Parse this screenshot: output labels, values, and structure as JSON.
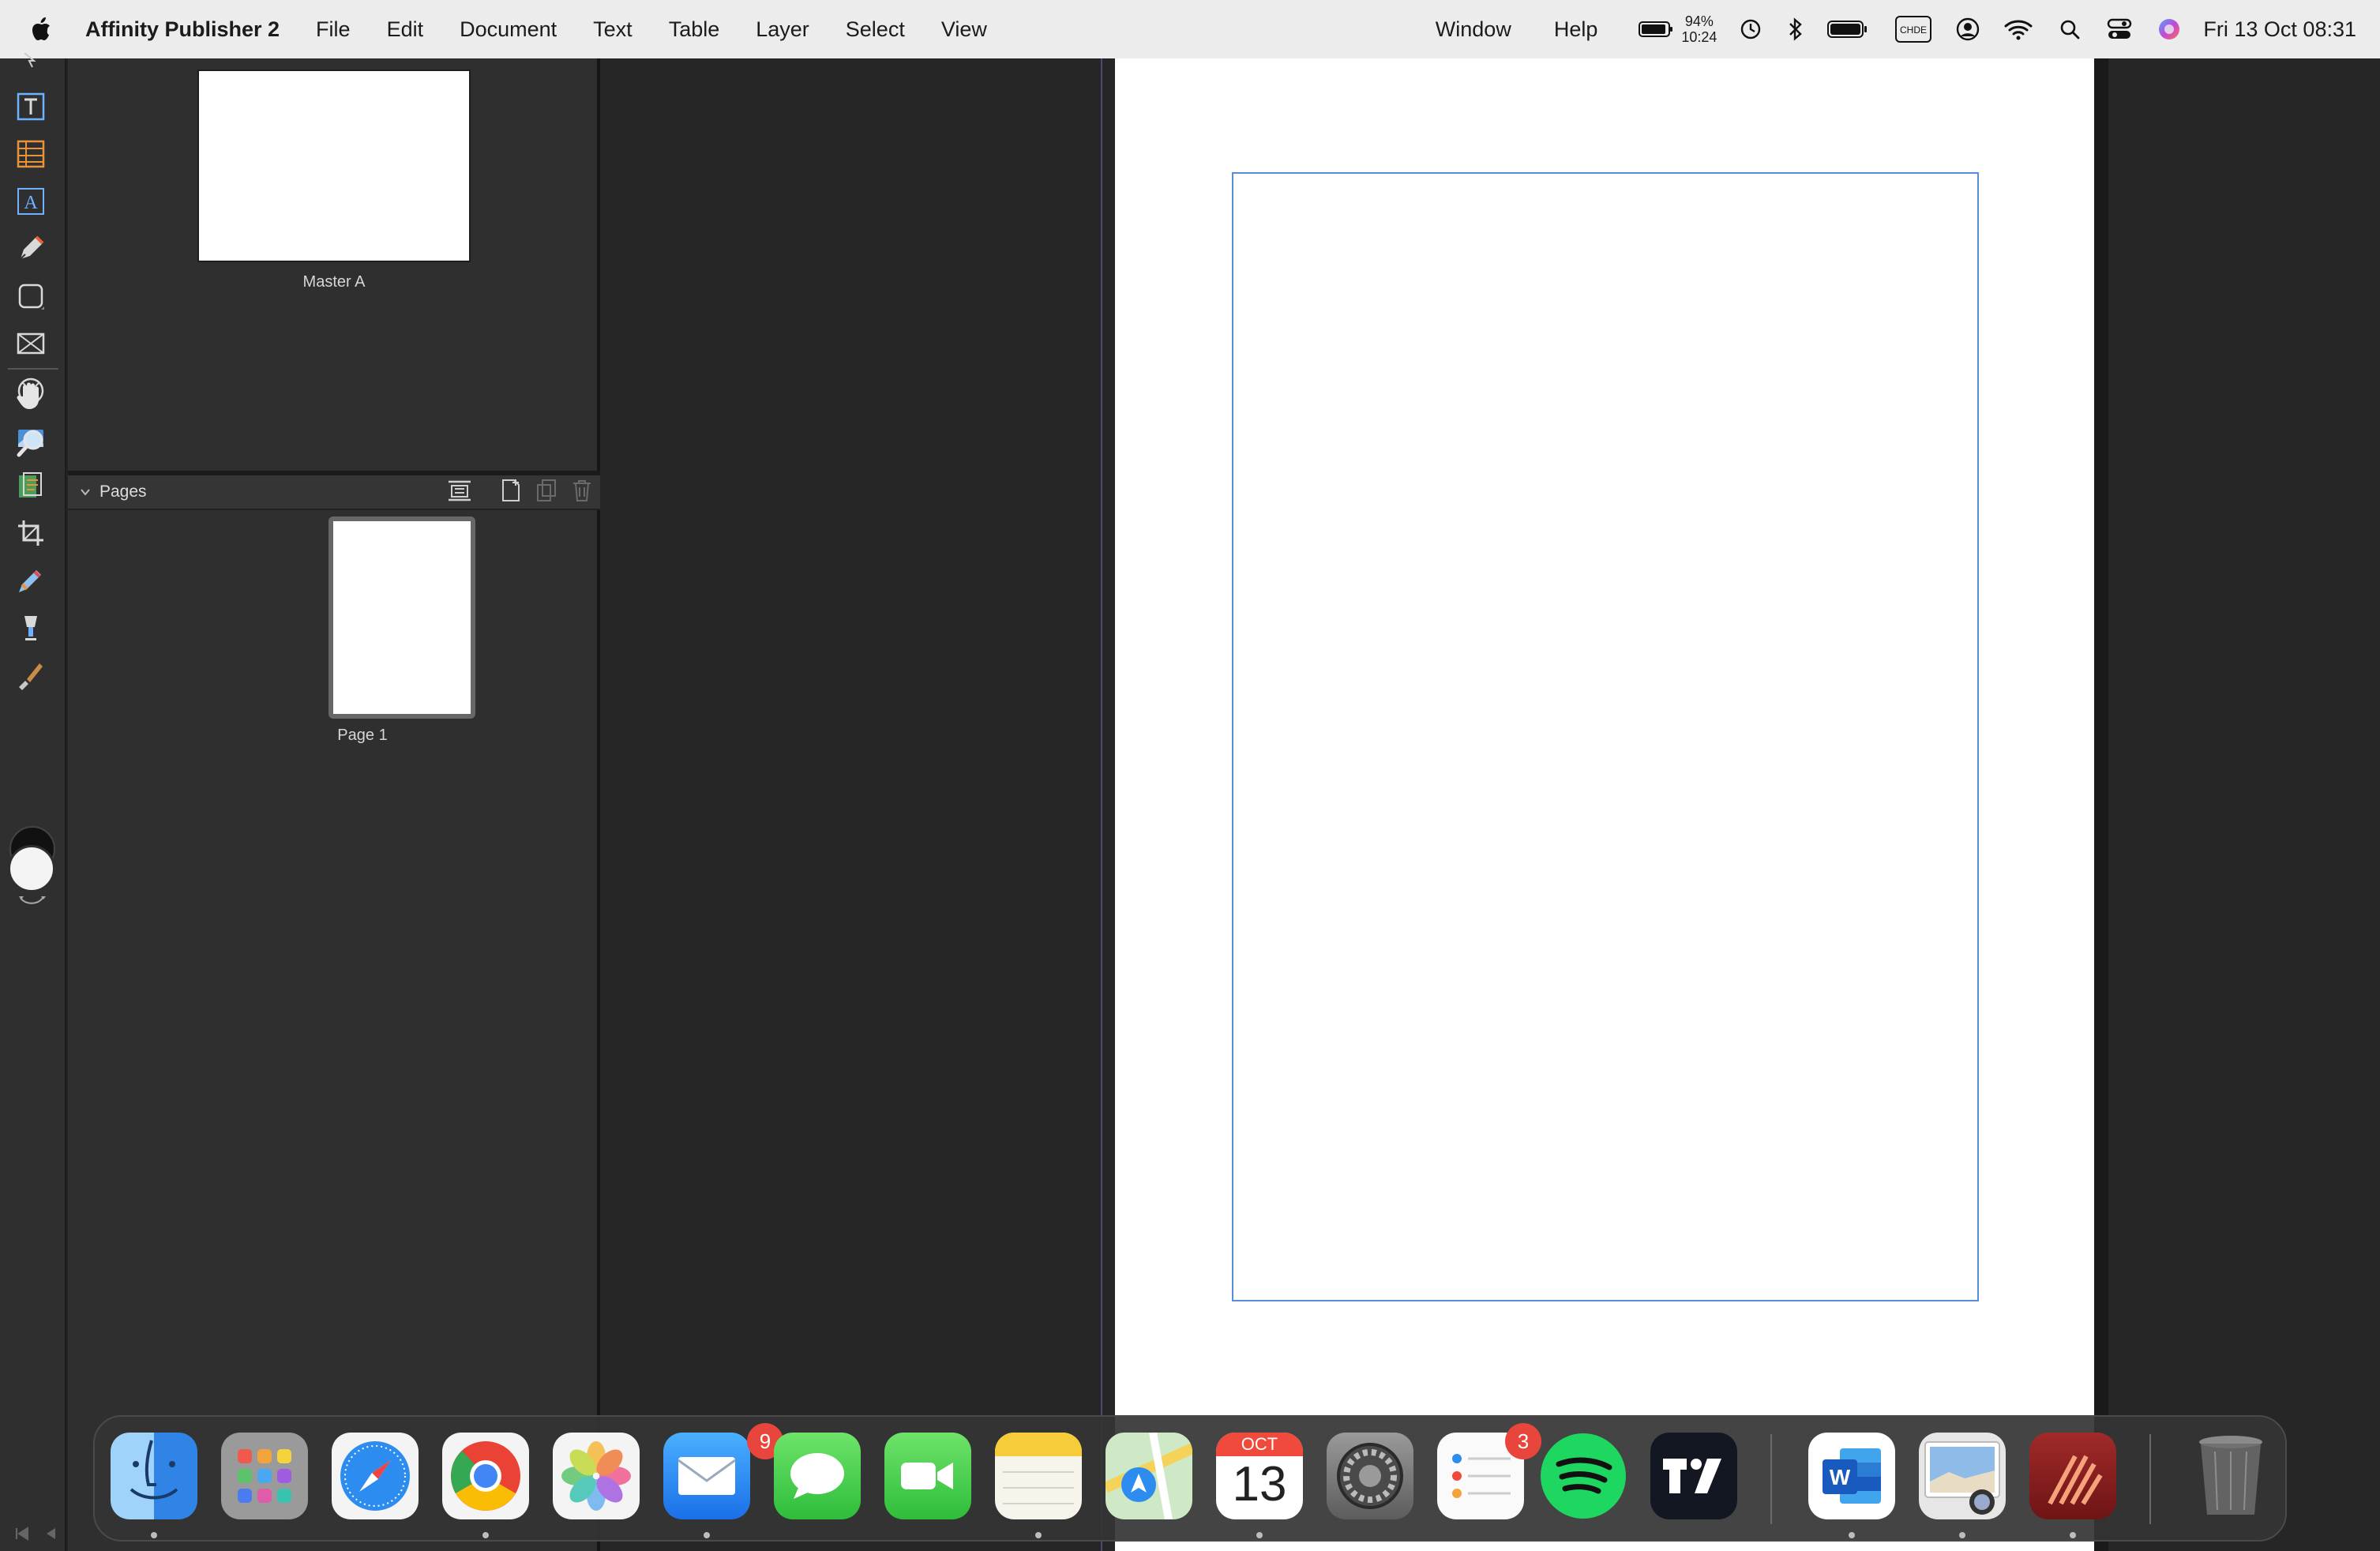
{
  "menubar": {
    "app_name": "Affinity Publisher 2",
    "menus": [
      "File",
      "Edit",
      "Document",
      "Text",
      "Table",
      "Layer",
      "Select",
      "View"
    ],
    "right_menus": [
      "Window",
      "Help"
    ],
    "battery_percent": "94%",
    "battery_time": "10:24",
    "kbd_label": "CHDE",
    "datetime": "Fri 13 Oct  08:31"
  },
  "tools": [
    "move-tool",
    "frame-text-tool",
    "table-tool",
    "artistic-text-tool",
    "pen-tool",
    "rectangle-tool",
    "picture-frame-tool",
    "ellipse-frame-tool",
    "place-image-tool",
    "pixel-tool",
    "crop-tool",
    "color-picker-tool",
    "fill-tool",
    "brush-tool",
    "hand-tool",
    "zoom-tool"
  ],
  "left_panel": {
    "master_label": "Master A",
    "pages_title": "Pages",
    "page_labels": [
      "Page 1"
    ]
  },
  "dock": {
    "apps": [
      {
        "name": "Finder",
        "badge": ""
      },
      {
        "name": "Launchpad",
        "badge": ""
      },
      {
        "name": "Safari",
        "badge": ""
      },
      {
        "name": "Chrome",
        "badge": ""
      },
      {
        "name": "Photos",
        "badge": ""
      },
      {
        "name": "Mail",
        "badge": "9"
      },
      {
        "name": "Messages",
        "badge": ""
      },
      {
        "name": "FaceTime",
        "badge": ""
      },
      {
        "name": "Notes",
        "badge": ""
      },
      {
        "name": "Maps",
        "badge": ""
      },
      {
        "name": "Calendar",
        "badge": "",
        "month": "OCT",
        "day": "13"
      },
      {
        "name": "System Settings",
        "badge": ""
      },
      {
        "name": "Reminders",
        "badge": "3"
      },
      {
        "name": "Spotify",
        "badge": ""
      },
      {
        "name": "TradingView",
        "badge": ""
      },
      {
        "name": "Word",
        "badge": ""
      },
      {
        "name": "Preview",
        "badge": ""
      },
      {
        "name": "Affinity Publisher",
        "badge": ""
      },
      {
        "name": "Trash",
        "badge": ""
      }
    ]
  },
  "colors": {
    "margin_guide": "#5a8cde",
    "bleed_guide": "#4b4a76",
    "badge": "#e8453c"
  }
}
